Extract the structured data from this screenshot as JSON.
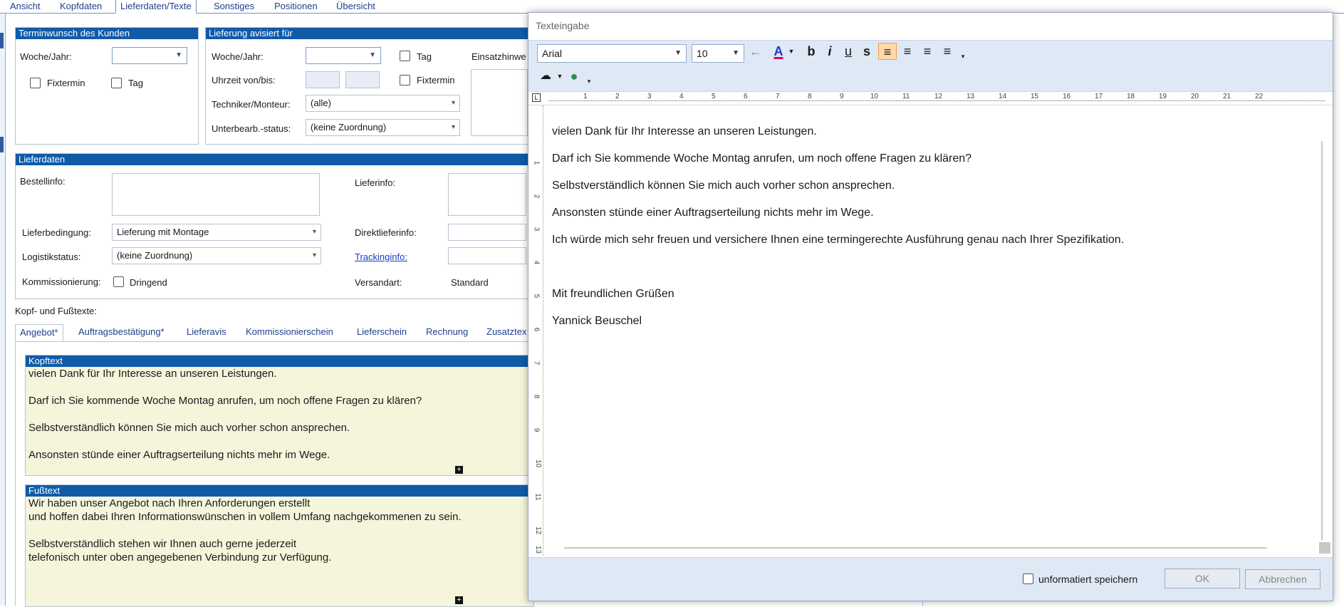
{
  "top_tabs": [
    "Ansicht",
    "Kopfdaten",
    "Lieferdaten/Texte",
    "Sonstiges",
    "Positionen",
    "Übersicht"
  ],
  "termin": {
    "header": "Terminwunsch des Kunden",
    "woche_label": "Woche/Jahr:",
    "fixtermin": "Fixtermin",
    "tag": "Tag"
  },
  "lieferung": {
    "header": "Lieferung avisiert für",
    "woche_label": "Woche/Jahr:",
    "tag": "Tag",
    "einsatz": "Einsatzhinwe",
    "uhrzeit_label": "Uhrzeit von/bis:",
    "fixtermin": "Fixtermin",
    "techniker_label": "Techniker/Monteur:",
    "techniker_value": "(alle)",
    "status_label": "Unterbearb.-status:",
    "status_value": "(keine Zuordnung)"
  },
  "lieferdaten": {
    "header": "Lieferdaten",
    "bestellinfo": "Bestellinfo:",
    "lieferinfo": "Lieferinfo:",
    "lieferbedingung_label": "Lieferbedingung:",
    "lieferbedingung_value": "Lieferung mit Montage",
    "direktlieferinfo": "Direktlieferinfo:",
    "logistik_label": "Logistikstatus:",
    "logistik_value": "(keine Zuordnung)",
    "trackinginfo": "Trackinginfo:",
    "kommission_label": "Kommissionierung:",
    "dringend": "Dringend",
    "versandart_label": "Versandart:",
    "versandart_value": "Standard"
  },
  "texte": {
    "section_label": "Kopf- und Fußtexte:",
    "tabs": [
      "Angebot*",
      "Auftragsbestätigung*",
      "Lieferavis",
      "Kommissionierschein",
      "Lieferschein",
      "Rechnung",
      "Zusatztex"
    ],
    "kopf_header": "Kopftext",
    "kopf_lines": [
      "vielen Dank für Ihr Interesse an unseren Leistungen.",
      "",
      "Darf ich Sie kommende Woche Montag anrufen, um noch offene Fragen zu klären?",
      "",
      "Selbstverständlich können Sie mich auch vorher schon ansprechen.",
      "",
      "Ansonsten stünde einer Auftragserteilung nichts mehr im Wege."
    ],
    "fuss_header": "Fußtext",
    "fuss_lines": [
      "Wir haben unser Angebot nach Ihren Anforderungen erstellt",
      "und hoffen dabei Ihren Informationswünschen in vollem Umfang nachgekommenen zu sein.",
      "",
      "Selbstverständlich stehen wir Ihnen auch gerne jederzeit",
      "telefonisch unter oben angegebenen Verbindung zur Verfügung."
    ]
  },
  "dialog": {
    "title": "Texteingabe",
    "font": "Arial",
    "size": "10",
    "toolbar": {
      "back": "←",
      "color": "A",
      "bold": "b",
      "italic": "i",
      "underline": "u",
      "strike": "s",
      "align_left": "≡",
      "align_center": "≡",
      "align_right": "≡",
      "justify": "≡"
    },
    "ruler_numbers": [
      "1",
      "2",
      "3",
      "4",
      "5",
      "6",
      "7",
      "8",
      "9",
      "10",
      "11",
      "12",
      "13",
      "14",
      "15",
      "16",
      "17",
      "18",
      "19",
      "20",
      "21",
      "22"
    ],
    "vruler_numbers": [
      "1",
      "2",
      "3",
      "4",
      "5",
      "6",
      "7",
      "8",
      "9",
      "10",
      "11",
      "12",
      "13"
    ],
    "lines": [
      "vielen Dank für Ihr Interesse an unseren Leistungen.",
      "Darf ich Sie kommende Woche Montag anrufen, um noch offene Fragen zu klären?",
      "Selbstverständlich können Sie mich auch vorher schon ansprechen.",
      "Ansonsten stünde einer Auftragserteilung nichts mehr im Wege.",
      "Ich würde mich sehr freuen und versichere Ihnen eine termingerechte Ausführung genau nach Ihrer Spezifikation.",
      "Mit freundlichen Grüßen",
      "Yannick Beuschel"
    ],
    "unformatted": "unformatiert speichern",
    "ok": "OK",
    "cancel": "Abbrechen"
  }
}
